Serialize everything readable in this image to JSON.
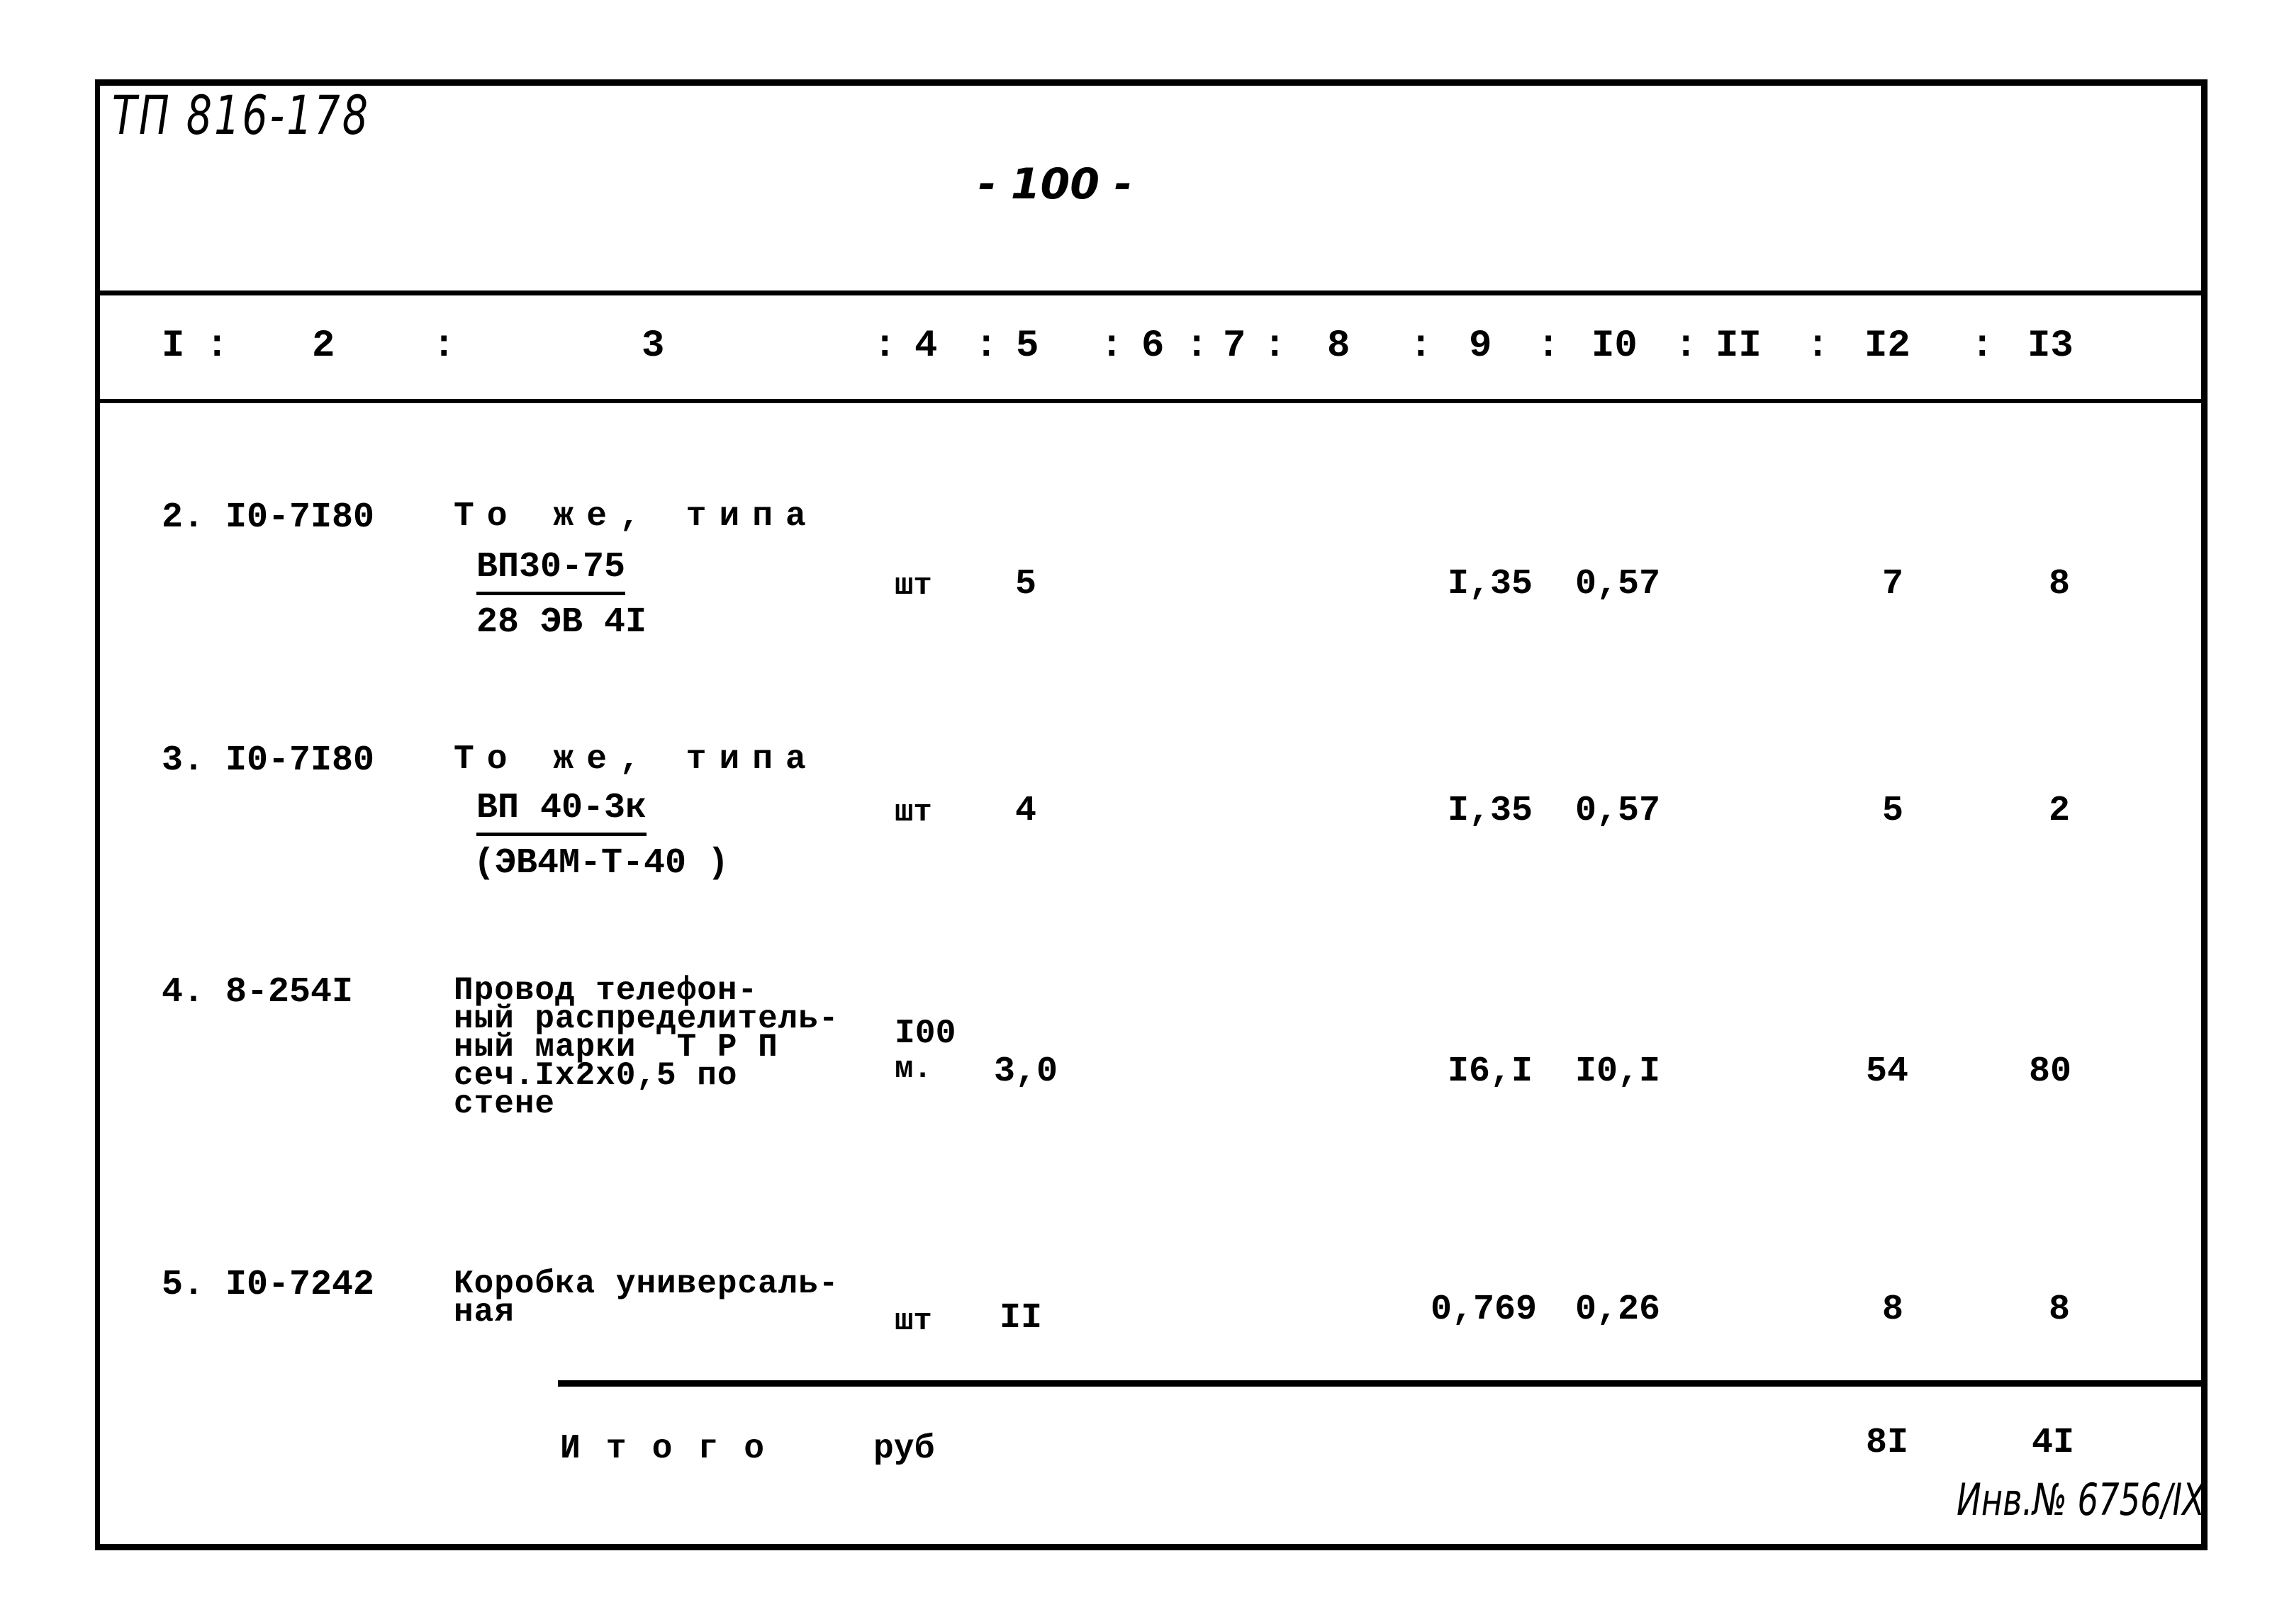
{
  "header": {
    "doc_code": "ТП 816-178",
    "page_number": "- 100 -"
  },
  "columns": [
    "I",
    "2",
    "3",
    "4",
    "5",
    "6",
    "7",
    "8",
    "9",
    "I0",
    "II",
    "I2",
    "I3"
  ],
  "rows": [
    {
      "num": "2.",
      "code": "I0-7I80",
      "desc_line1": "То же, типа",
      "desc_type": "ВП30-75",
      "desc_sub": "28 ЭВ 4I",
      "unit": "шт",
      "qty": "5",
      "col9": "I,35",
      "col10": "0,57",
      "col12": "7",
      "col13": "8"
    },
    {
      "num": "3.",
      "code": "I0-7I80",
      "desc_line1": "То же, типа",
      "desc_type": "ВП 40-3к",
      "desc_sub": "(ЭВ4М-Т-40 )",
      "unit": "шт",
      "qty": "4",
      "col9": "I,35",
      "col10": "0,57",
      "col12": "5",
      "col13": "2"
    },
    {
      "num": "4.",
      "code": "8-254I",
      "desc_lines": [
        "Провод телефон-",
        "ный распределитель-",
        "ный марки  Т Р П",
        "сеч.Iх2х0,5 по",
        "стене"
      ],
      "unit_line1": "I00",
      "unit_line2": "м.",
      "qty": "3,0",
      "col9": "I6,I",
      "col10": "I0,I",
      "col12": "54",
      "col13": "80"
    },
    {
      "num": "5.",
      "code": "I0-7242",
      "desc_lines": [
        "Коробка универсаль-",
        "ная"
      ],
      "unit": "шт",
      "qty": "II",
      "col9": "0,769",
      "col10": "0,26",
      "col12": "8",
      "col13": "8"
    }
  ],
  "total": {
    "label": "Итого",
    "unit": "руб",
    "col12": "8I",
    "col13": "4I"
  },
  "inventory_stamp": "Инв.№ 6756/IX"
}
